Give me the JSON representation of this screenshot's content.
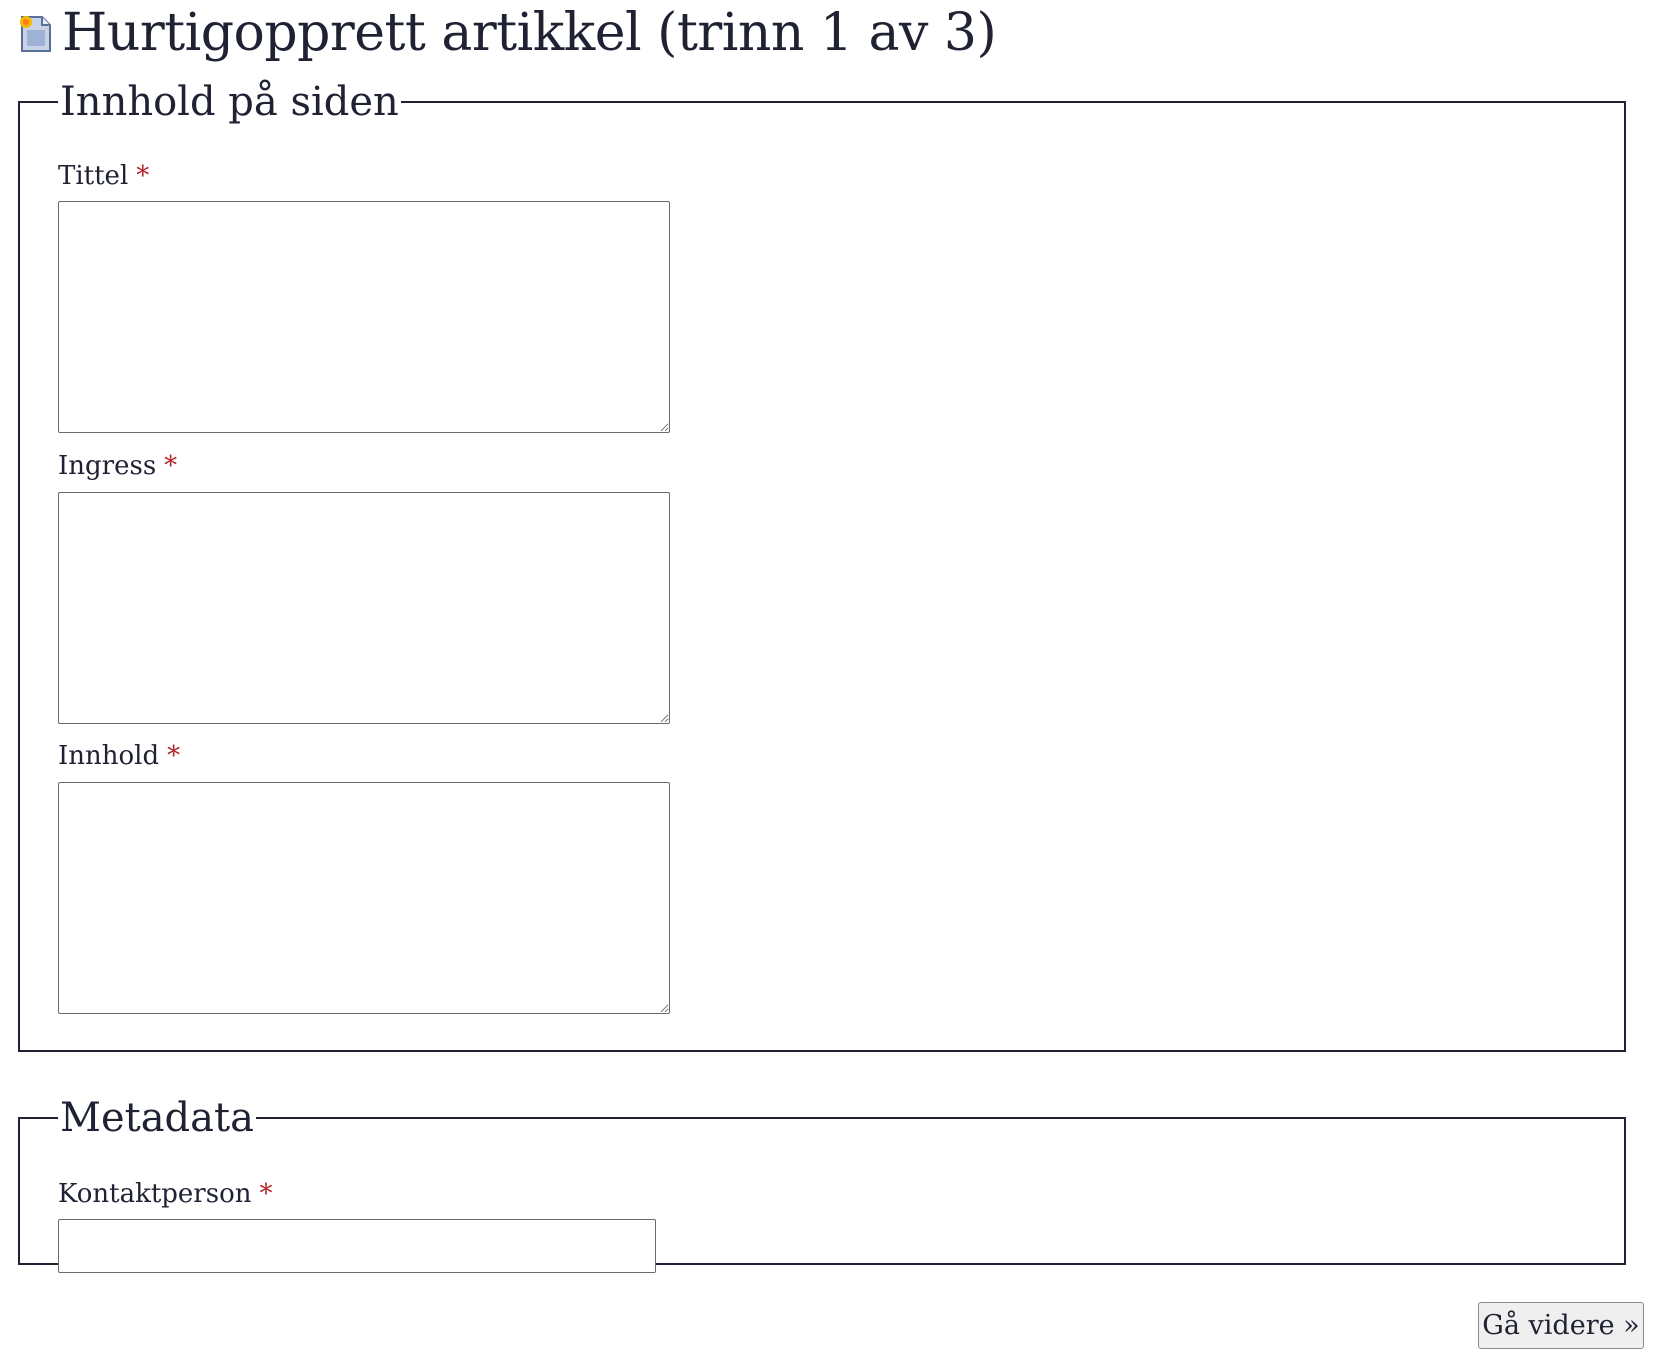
{
  "page": {
    "title": "Hurtigopprett artikkel (trinn 1 av 3)",
    "icon": "new-document-icon"
  },
  "content_section": {
    "legend": "Innhold på siden",
    "fields": [
      {
        "label": "Tittel",
        "required_marker": "*",
        "value": ""
      },
      {
        "label": "Ingress",
        "required_marker": "*",
        "value": ""
      },
      {
        "label": "Innhold",
        "required_marker": "*",
        "value": ""
      }
    ]
  },
  "metadata_section": {
    "legend": "Metadata",
    "contact_person": {
      "label": "Kontaktperson",
      "required_marker": "*",
      "value": ""
    }
  },
  "actions": {
    "next_label": "Gå videre »"
  },
  "colors": {
    "text": "#1f2233",
    "required": "#b3262b",
    "button_bg": "#efefef"
  }
}
